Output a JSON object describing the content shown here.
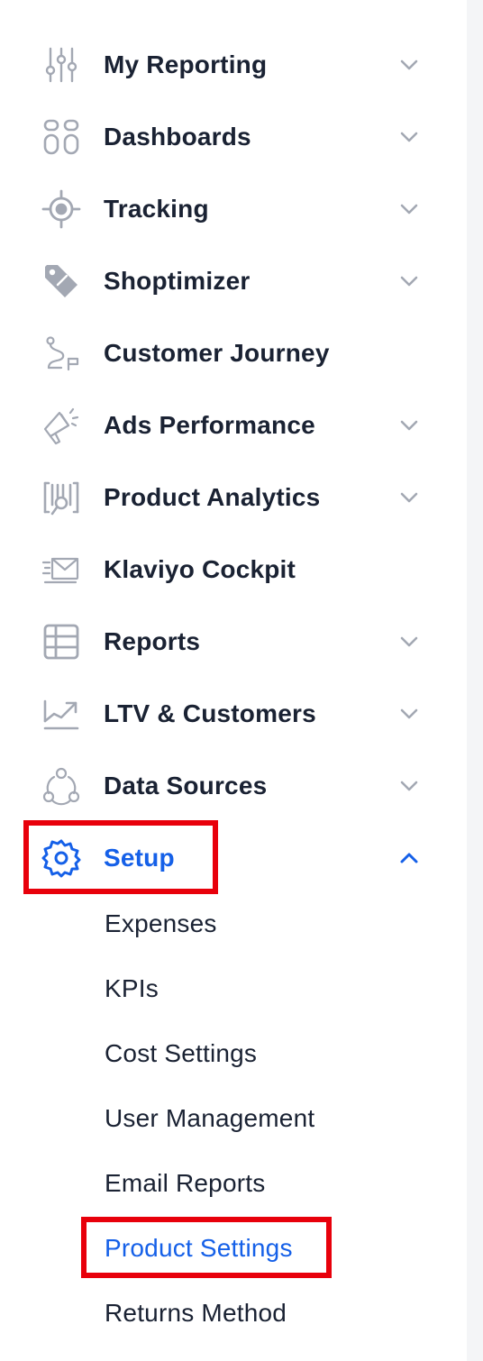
{
  "nav": {
    "items": [
      {
        "label": "My Reporting",
        "icon": "sliders-icon",
        "chevron": "chevron-down-icon"
      },
      {
        "label": "Dashboards",
        "icon": "dashboard-tiles-icon",
        "chevron": "chevron-down-icon"
      },
      {
        "label": "Tracking",
        "icon": "crosshair-icon",
        "chevron": "chevron-down-icon"
      },
      {
        "label": "Shoptimizer",
        "icon": "price-tag-icon",
        "chevron": "chevron-down-icon"
      },
      {
        "label": "Customer Journey",
        "icon": "journey-path-icon"
      },
      {
        "label": "Ads Performance",
        "icon": "megaphone-icon",
        "chevron": "chevron-down-icon"
      },
      {
        "label": "Product Analytics",
        "icon": "barcode-magnifier-icon",
        "chevron": "chevron-down-icon"
      },
      {
        "label": "Klaviyo Cockpit",
        "icon": "envelope-icon"
      },
      {
        "label": "Reports",
        "icon": "table-icon",
        "chevron": "chevron-down-icon"
      },
      {
        "label": "LTV & Customers",
        "icon": "trend-chart-icon",
        "chevron": "chevron-down-icon"
      },
      {
        "label": "Data Sources",
        "icon": "connections-icon",
        "chevron": "chevron-down-icon"
      },
      {
        "label": "Setup",
        "icon": "gear-icon",
        "chevron": "chevron-up-icon",
        "active": true
      }
    ],
    "setup_subitems": [
      {
        "label": "Expenses"
      },
      {
        "label": "KPIs"
      },
      {
        "label": "Cost Settings"
      },
      {
        "label": "User Management"
      },
      {
        "label": "Email Reports"
      },
      {
        "label": "Product Settings",
        "active": true
      },
      {
        "label": "Returns Method"
      }
    ]
  },
  "colors": {
    "text": "#1a2233",
    "icon_gray": "#a3a8b3",
    "active_blue": "#1560e8",
    "highlight_red": "#e8000b",
    "side_strip": "#f4f5f7"
  }
}
